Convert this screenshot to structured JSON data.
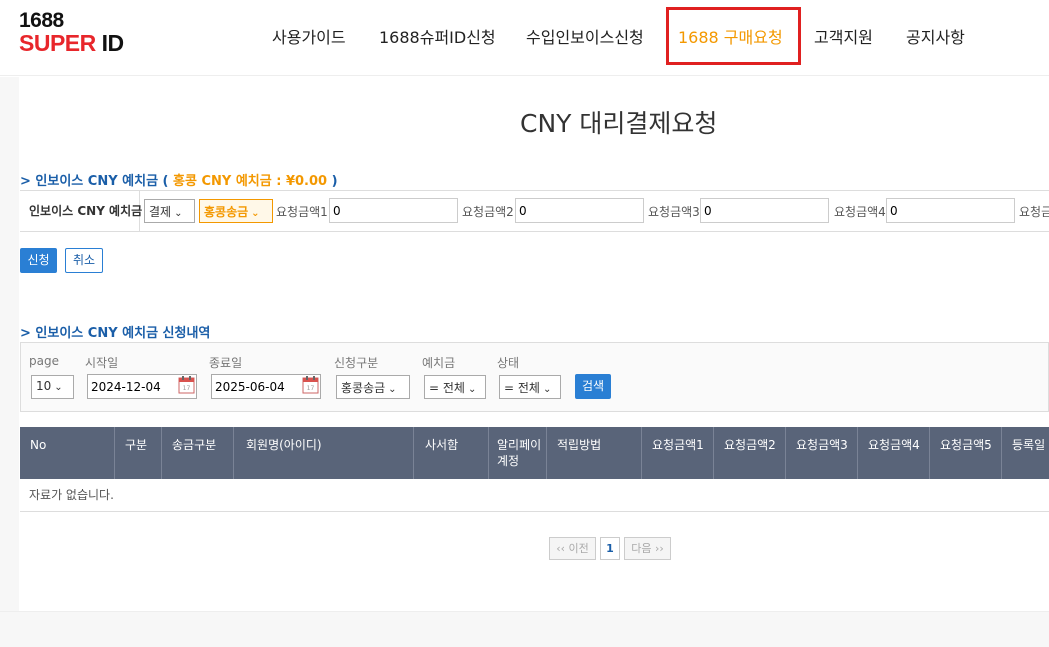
{
  "logo": {
    "line1": "1688",
    "line2a": "SUPER",
    "line2b": " ID"
  },
  "nav": {
    "items": [
      {
        "label": "사용가이드"
      },
      {
        "label": "1688슈퍼ID신청"
      },
      {
        "label": "수입인보이스신청"
      },
      {
        "label": "1688 구매요청"
      },
      {
        "label": "고객지원"
      },
      {
        "label": "공지사항"
      }
    ]
  },
  "main": {
    "title": "CNY 대리결제요청",
    "deposit_section": {
      "title": "> 인보이스 CNY 예치금 (",
      "hk_label": " 홍콩 CNY 예치금 : ¥0.00",
      "title_end": " )",
      "form_label": "인보이스 CNY 예치금",
      "type_select": "결제",
      "method_select": "홍콩송금",
      "amounts": [
        {
          "label": "요청금액1",
          "value": "0"
        },
        {
          "label": "요청금액2",
          "value": "0"
        },
        {
          "label": "요청금액3",
          "value": "0"
        },
        {
          "label": "요청금액4",
          "value": "0"
        },
        {
          "label": "요청금"
        }
      ],
      "submit_label": "신청",
      "cancel_label": "취소"
    },
    "history_section": {
      "title": "> 인보이스 CNY 예치금 신청내역",
      "filters": {
        "page_label": "page",
        "page_value": "10",
        "start_label": "시작일",
        "start_value": "2024-12-04",
        "end_label": "종료일",
        "end_value": "2025-06-04",
        "type_label": "신청구분",
        "type_value": "홍콩송금",
        "deposit_label": "예치금",
        "deposit_value": "= 전체",
        "status_label": "상태",
        "status_value": "= 전체",
        "search_label": "검색"
      },
      "columns": [
        "No",
        "구분",
        "송금구분",
        "회원명(아이디)",
        "사서함",
        "알리페이\n계정",
        "적립방법",
        "요청금액1",
        "요청금액2",
        "요청금액3",
        "요청금액4",
        "요청금액5",
        "등록일"
      ],
      "empty_text": "자료가 없습니다.",
      "pagination": {
        "prev": "‹‹ 이전",
        "current": "1",
        "next": "다음 ››"
      }
    }
  },
  "colors": {
    "accent": "#f39800",
    "primary": "#2a7fd4",
    "header_bg": "#596479",
    "highlight": "#e02020"
  }
}
